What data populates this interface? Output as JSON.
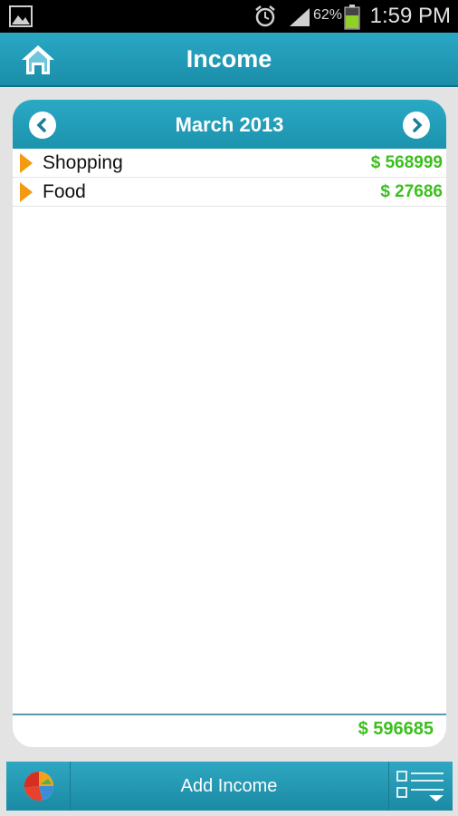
{
  "status_bar": {
    "battery_percent": "62%",
    "time": "1:59 PM",
    "icons": [
      "gallery-icon",
      "alarm-icon",
      "signal-icon",
      "battery-icon"
    ]
  },
  "header": {
    "title": "Income",
    "home_icon": "home-icon"
  },
  "period": {
    "label": "March 2013",
    "prev_icon": "chevron-left-icon",
    "next_icon": "chevron-right-icon"
  },
  "entries": [
    {
      "name": "Shopping",
      "amount": "$ 568999"
    },
    {
      "name": "Food",
      "amount": "$ 27686"
    }
  ],
  "total": "$ 596685",
  "toolbar": {
    "chart_icon": "pie-chart-icon",
    "add_label": "Add Income",
    "menu_icon": "list-menu-icon"
  },
  "colors": {
    "accent": "#1f98b3",
    "amount": "#3cbf1e",
    "marker": "#f39a12"
  }
}
